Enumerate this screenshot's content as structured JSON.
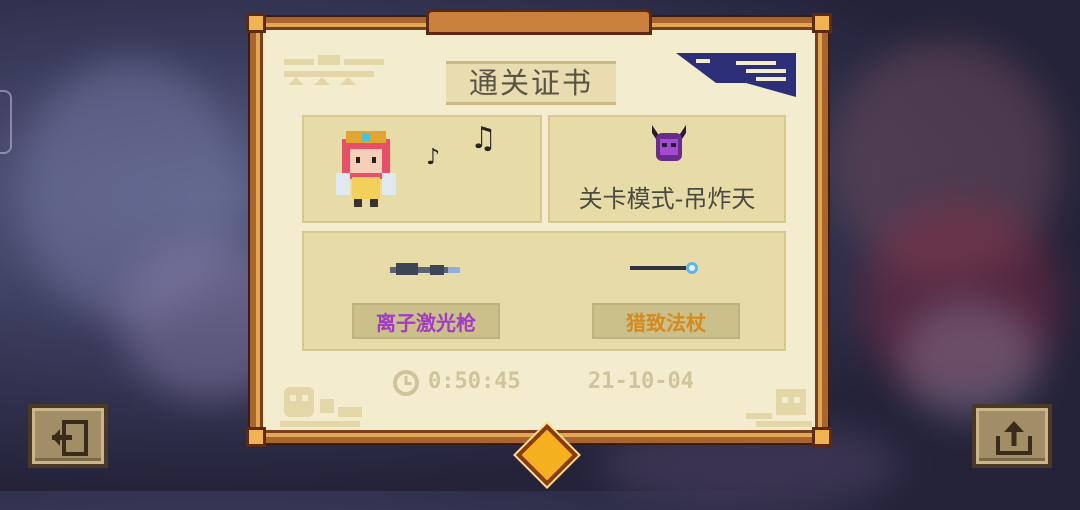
{
  "certificate": {
    "title": "通关证书",
    "mode_label": "关卡模式-吊炸天",
    "weapons": [
      {
        "name": "离子激光枪",
        "color": "#a23cc4"
      },
      {
        "name": "猎致法杖",
        "color": "#d48a1c"
      }
    ],
    "clear_time": "0:50:45",
    "date": "21-10-04"
  },
  "icons": {
    "exit": "exit-door-icon",
    "share": "share-upload-icon",
    "clock": "clock-icon",
    "music": "music-note-icon",
    "boss": "demon-helmet-icon"
  },
  "colors": {
    "frame": "#a8662e",
    "paper": "#f4ecce",
    "panel": "#e7dca8",
    "accent_gem": "#f5b020"
  }
}
